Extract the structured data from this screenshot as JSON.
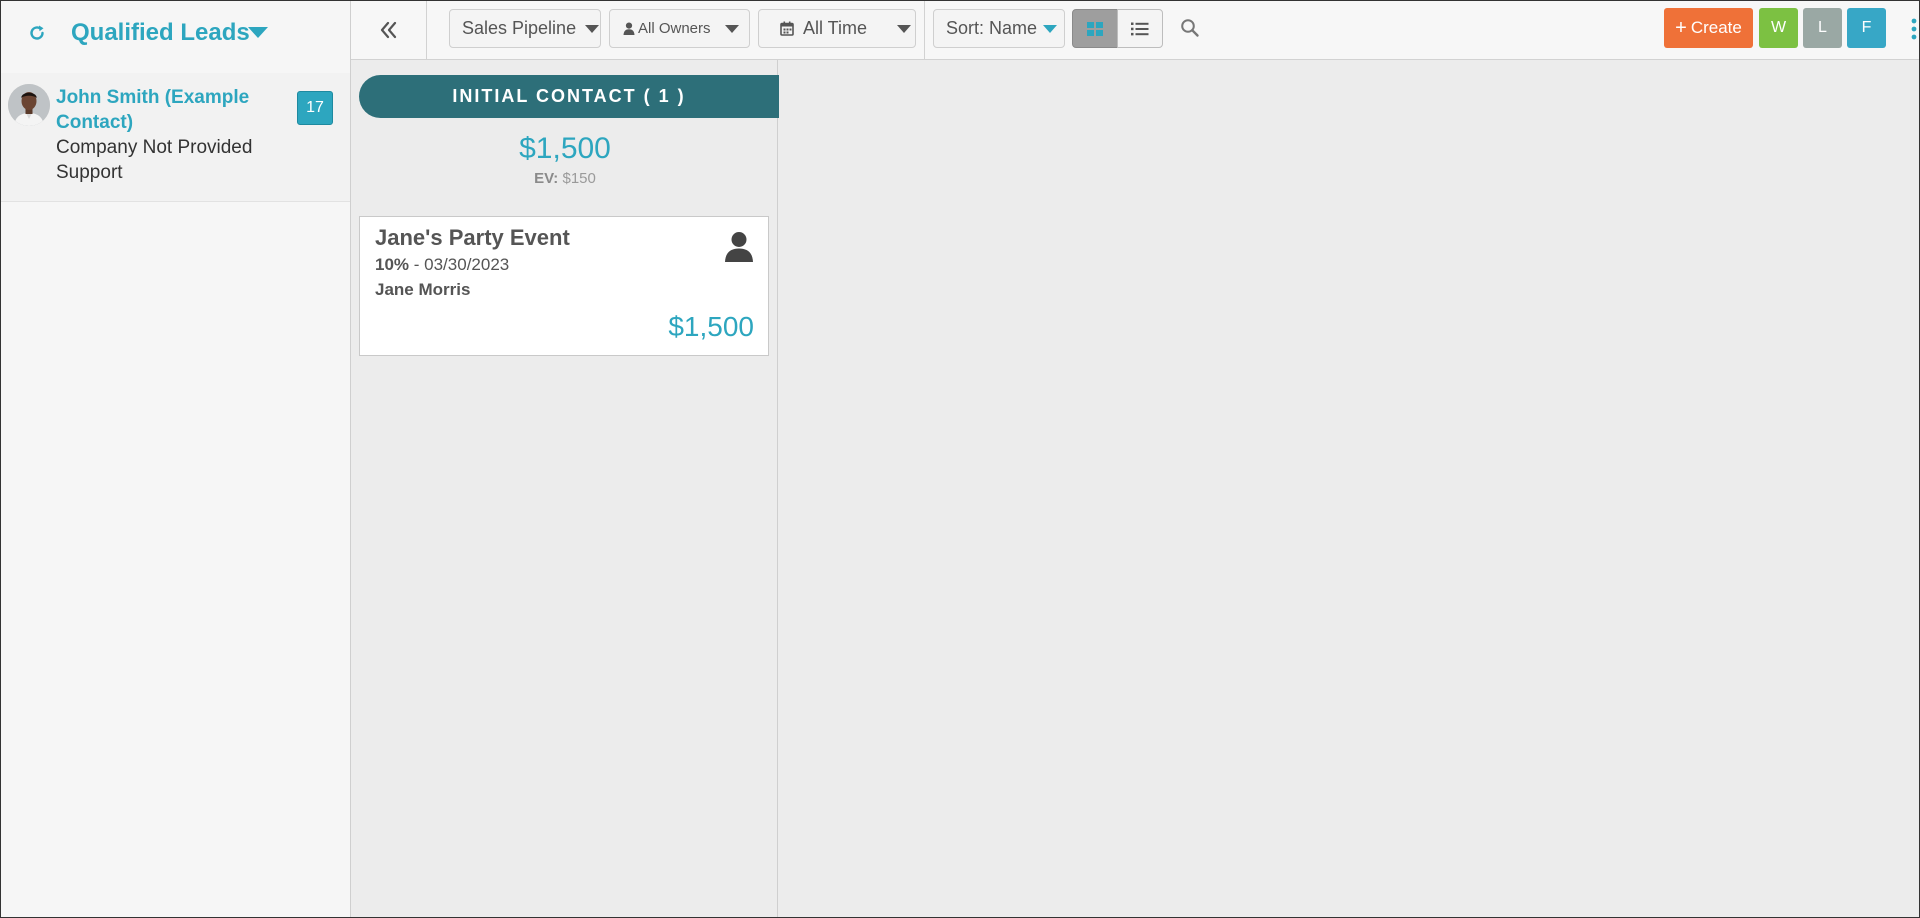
{
  "sidebar": {
    "list_title": "Qualified Leads",
    "contacts": [
      {
        "name": "John Smith (Example Contact)",
        "company": "Company Not Provided",
        "tag": "Support",
        "count": "17"
      }
    ]
  },
  "toolbar": {
    "pipeline_label": "Sales Pipeline",
    "owners_label": "All Owners",
    "time_label": "All Time",
    "sort_label": "Sort: Name",
    "create_label": "Create",
    "users": [
      {
        "initial": "W",
        "color": "#7cc142"
      },
      {
        "initial": "L",
        "color": "#9aa8a4"
      },
      {
        "initial": "F",
        "color": "#37a7c6"
      }
    ]
  },
  "board": {
    "columns": [
      {
        "stage_label": "INITIAL CONTACT ( 1 )",
        "total": "$1,500",
        "ev_label": "EV:",
        "ev_value": "$150",
        "cards": [
          {
            "title": "Jane's Party Event",
            "probability": "10%",
            "date_text": "- 03/30/2023",
            "owner": "Jane Morris",
            "value": "$1,500"
          }
        ]
      }
    ]
  },
  "colors": {
    "accent": "#2da6bf",
    "stage_header": "#2d6f79",
    "create": "#ef7138"
  }
}
